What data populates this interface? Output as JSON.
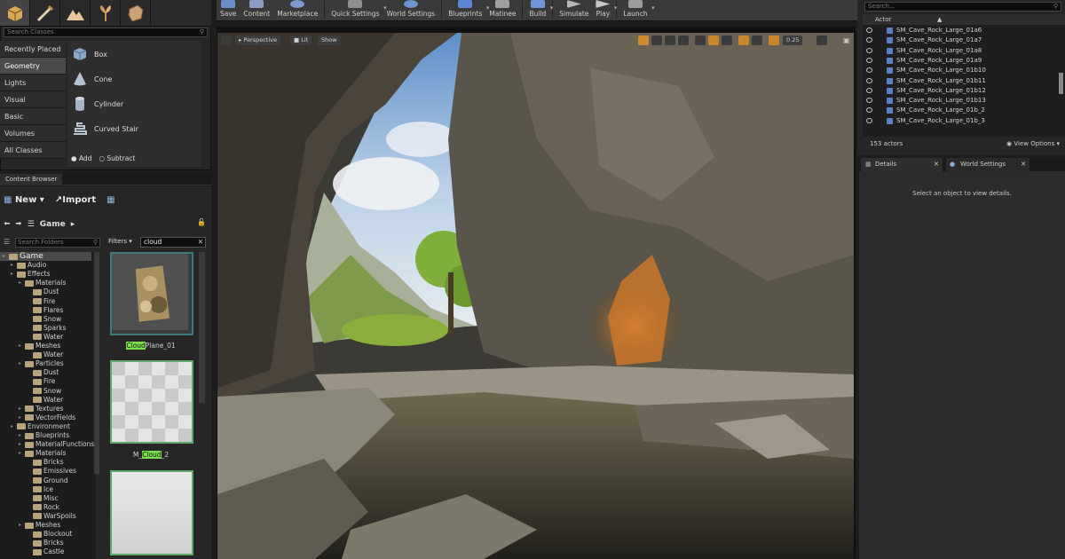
{
  "toolbar": {
    "buttons": [
      {
        "label": "Save",
        "icon": "save-icon",
        "color": "#6a8fc8"
      },
      {
        "label": "Content",
        "icon": "content-icon",
        "color": "#8a9cc0"
      },
      {
        "label": "Marketplace",
        "icon": "marketplace-icon",
        "color": "#7a9ad0"
      },
      {
        "label": "Quick Settings",
        "icon": "quick-settings-icon",
        "color": "#8f8f8f"
      },
      {
        "label": "World Settings",
        "icon": "world-settings-icon",
        "color": "#6d94cc"
      },
      {
        "label": "Blueprints",
        "icon": "blueprints-icon",
        "color": "#5c86d4"
      },
      {
        "label": "Matinee",
        "icon": "matinee-icon",
        "color": "#a0a0a0"
      },
      {
        "label": "Build",
        "icon": "build-icon",
        "color": "#6f95d6"
      },
      {
        "label": "Simulate",
        "icon": "simulate-icon",
        "color": "#b8b8b8"
      },
      {
        "label": "Play",
        "icon": "play-icon",
        "color": "#c8c8c8"
      },
      {
        "label": "Launch",
        "icon": "launch-icon",
        "color": "#9a9a9a"
      }
    ]
  },
  "modes": {
    "tabs": [
      "place-mode-icon",
      "paint-mode-icon",
      "landscape-mode-icon",
      "foliage-mode-icon",
      "geometry-mode-icon"
    ]
  },
  "place": {
    "search_placeholder": "Search Classes",
    "categories": [
      "Recently Placed",
      "Geometry",
      "Lights",
      "Visual",
      "Basic",
      "Volumes",
      "All Classes"
    ],
    "active_category": "Geometry",
    "items": [
      {
        "label": "Box",
        "icon": "box-icon"
      },
      {
        "label": "Cone",
        "icon": "cone-icon"
      },
      {
        "label": "Cylinder",
        "icon": "cylinder-icon"
      },
      {
        "label": "Curved Stair",
        "icon": "curved-stair-icon"
      }
    ],
    "add_label": "Add",
    "subtract_label": "Subtract"
  },
  "content_browser": {
    "tab_label": "Content Browser",
    "new_label": "New",
    "import_label": "Import",
    "path": "Game",
    "folder_search_placeholder": "Search Folders",
    "filters_label": "Filters",
    "filter_text": "cloud",
    "tree": [
      {
        "label": "Game",
        "depth": 0
      },
      {
        "label": "Audio",
        "depth": 1
      },
      {
        "label": "Effects",
        "depth": 1
      },
      {
        "label": "Materials",
        "depth": 2
      },
      {
        "label": "Dust",
        "depth": 3
      },
      {
        "label": "Fire",
        "depth": 3
      },
      {
        "label": "Flares",
        "depth": 3
      },
      {
        "label": "Snow",
        "depth": 3
      },
      {
        "label": "Sparks",
        "depth": 3
      },
      {
        "label": "Water",
        "depth": 3
      },
      {
        "label": "Meshes",
        "depth": 2
      },
      {
        "label": "Water",
        "depth": 3
      },
      {
        "label": "Particles",
        "depth": 2
      },
      {
        "label": "Dust",
        "depth": 3
      },
      {
        "label": "Fire",
        "depth": 3
      },
      {
        "label": "Snow",
        "depth": 3
      },
      {
        "label": "Water",
        "depth": 3
      },
      {
        "label": "Textures",
        "depth": 2
      },
      {
        "label": "VectorFields",
        "depth": 2
      },
      {
        "label": "Environment",
        "depth": 1
      },
      {
        "label": "Blueprints",
        "depth": 2
      },
      {
        "label": "MaterialFunctions",
        "depth": 2
      },
      {
        "label": "Materials",
        "depth": 2
      },
      {
        "label": "Bricks",
        "depth": 3
      },
      {
        "label": "Emissives",
        "depth": 3
      },
      {
        "label": "Ground",
        "depth": 3
      },
      {
        "label": "Ice",
        "depth": 3
      },
      {
        "label": "Misc",
        "depth": 3
      },
      {
        "label": "Rock",
        "depth": 3
      },
      {
        "label": "WarSpoils",
        "depth": 3
      },
      {
        "label": "Meshes",
        "depth": 2
      },
      {
        "label": "Blockout",
        "depth": 3
      },
      {
        "label": "Bricks",
        "depth": 3
      },
      {
        "label": "Castle",
        "depth": 3
      }
    ],
    "assets": [
      {
        "pre": "",
        "match": "Cloud",
        "post": "Plane_01"
      },
      {
        "pre": "M_",
        "match": "Cloud",
        "post": "_2"
      }
    ]
  },
  "viewport": {
    "perspective_label": "Perspective",
    "lit_label": "Lit",
    "show_label": "Show",
    "snap_value": "0.25"
  },
  "outliner": {
    "search_placeholder": "Search...",
    "column_label": "Actor",
    "rows": [
      "SM_Cave_Rock_Large_01a6",
      "SM_Cave_Rock_Large_01a7",
      "SM_Cave_Rock_Large_01a8",
      "SM_Cave_Rock_Large_01a9",
      "SM_Cave_Rock_Large_01b10",
      "SM_Cave_Rock_Large_01b11",
      "SM_Cave_Rock_Large_01b12",
      "SM_Cave_Rock_Large_01b13",
      "SM_Cave_Rock_Large_01b_2",
      "SM_Cave_Rock_Large_01b_3"
    ],
    "actor_count": "153 actors",
    "view_options_label": "View Options"
  },
  "details": {
    "tab_details": "Details",
    "tab_world_settings": "World Settings",
    "empty_message": "Select an object to view details."
  }
}
